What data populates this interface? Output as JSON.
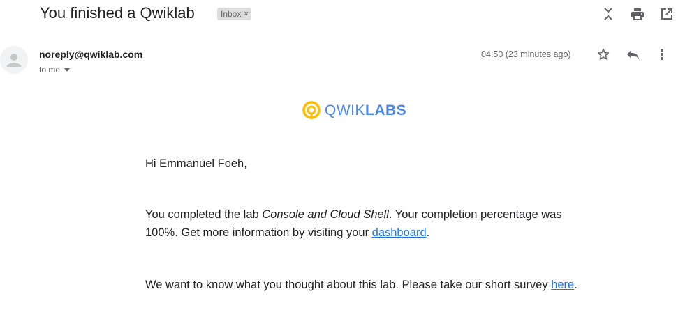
{
  "email": {
    "subject": "You finished a Qwiklab",
    "label": "Inbox",
    "label_remove": "×",
    "sender": "noreply@qwiklab.com",
    "to": "to me",
    "timestamp": "04:50 (23 minutes ago)"
  },
  "icons": {
    "top": [
      "expand-collapse-icon",
      "print-icon",
      "open-in-new-window-icon"
    ],
    "message": [
      "star-icon",
      "reply-icon",
      "more-vert-icon"
    ],
    "avatar": "person-avatar-icon"
  },
  "logo": {
    "prefix": "QWIK",
    "suffix": "LABS",
    "colors": [
      "#fbbc04",
      "#4a86e8"
    ]
  },
  "body": {
    "greeting": "Hi Emmanuel Foeh,",
    "p1_before": "You completed the lab ",
    "p1_lab": "Console and Cloud Shell",
    "p1_middle": ". Your completion percentage was 100%. Get more information by visiting your ",
    "p1_link": "dashboard",
    "p1_after": ".",
    "p2_before": "We want to know what you thought about this lab. Please take our short survey ",
    "p2_link": "here",
    "p2_after": "."
  },
  "colors": {
    "link": "#1a73e8",
    "chip_bg": "#dddddd",
    "muted": "#5f6368"
  }
}
